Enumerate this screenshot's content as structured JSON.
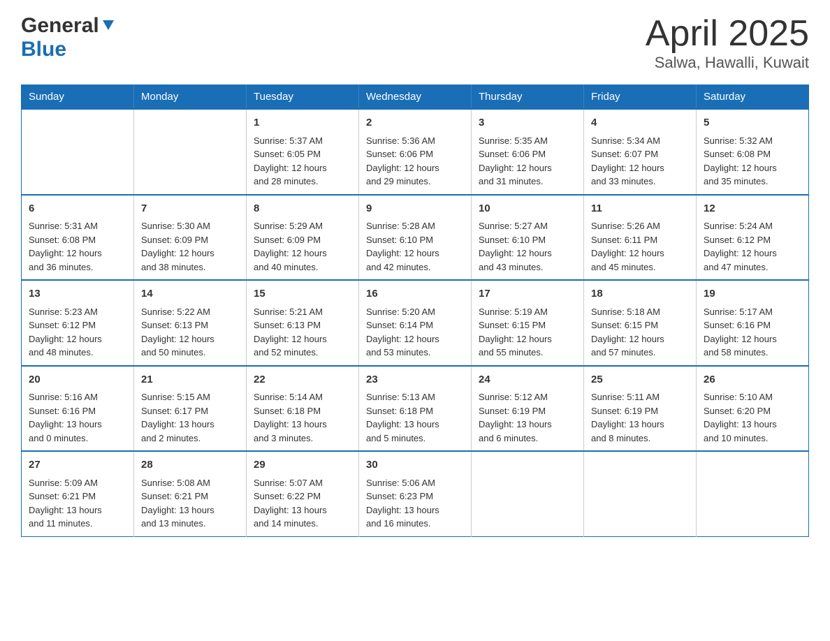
{
  "header": {
    "logo_general": "General",
    "logo_blue": "Blue",
    "title": "April 2025",
    "subtitle": "Salwa, Hawalli, Kuwait"
  },
  "calendar": {
    "days_of_week": [
      "Sunday",
      "Monday",
      "Tuesday",
      "Wednesday",
      "Thursday",
      "Friday",
      "Saturday"
    ],
    "weeks": [
      [
        {
          "day": "",
          "info": ""
        },
        {
          "day": "",
          "info": ""
        },
        {
          "day": "1",
          "info": "Sunrise: 5:37 AM\nSunset: 6:05 PM\nDaylight: 12 hours\nand 28 minutes."
        },
        {
          "day": "2",
          "info": "Sunrise: 5:36 AM\nSunset: 6:06 PM\nDaylight: 12 hours\nand 29 minutes."
        },
        {
          "day": "3",
          "info": "Sunrise: 5:35 AM\nSunset: 6:06 PM\nDaylight: 12 hours\nand 31 minutes."
        },
        {
          "day": "4",
          "info": "Sunrise: 5:34 AM\nSunset: 6:07 PM\nDaylight: 12 hours\nand 33 minutes."
        },
        {
          "day": "5",
          "info": "Sunrise: 5:32 AM\nSunset: 6:08 PM\nDaylight: 12 hours\nand 35 minutes."
        }
      ],
      [
        {
          "day": "6",
          "info": "Sunrise: 5:31 AM\nSunset: 6:08 PM\nDaylight: 12 hours\nand 36 minutes."
        },
        {
          "day": "7",
          "info": "Sunrise: 5:30 AM\nSunset: 6:09 PM\nDaylight: 12 hours\nand 38 minutes."
        },
        {
          "day": "8",
          "info": "Sunrise: 5:29 AM\nSunset: 6:09 PM\nDaylight: 12 hours\nand 40 minutes."
        },
        {
          "day": "9",
          "info": "Sunrise: 5:28 AM\nSunset: 6:10 PM\nDaylight: 12 hours\nand 42 minutes."
        },
        {
          "day": "10",
          "info": "Sunrise: 5:27 AM\nSunset: 6:10 PM\nDaylight: 12 hours\nand 43 minutes."
        },
        {
          "day": "11",
          "info": "Sunrise: 5:26 AM\nSunset: 6:11 PM\nDaylight: 12 hours\nand 45 minutes."
        },
        {
          "day": "12",
          "info": "Sunrise: 5:24 AM\nSunset: 6:12 PM\nDaylight: 12 hours\nand 47 minutes."
        }
      ],
      [
        {
          "day": "13",
          "info": "Sunrise: 5:23 AM\nSunset: 6:12 PM\nDaylight: 12 hours\nand 48 minutes."
        },
        {
          "day": "14",
          "info": "Sunrise: 5:22 AM\nSunset: 6:13 PM\nDaylight: 12 hours\nand 50 minutes."
        },
        {
          "day": "15",
          "info": "Sunrise: 5:21 AM\nSunset: 6:13 PM\nDaylight: 12 hours\nand 52 minutes."
        },
        {
          "day": "16",
          "info": "Sunrise: 5:20 AM\nSunset: 6:14 PM\nDaylight: 12 hours\nand 53 minutes."
        },
        {
          "day": "17",
          "info": "Sunrise: 5:19 AM\nSunset: 6:15 PM\nDaylight: 12 hours\nand 55 minutes."
        },
        {
          "day": "18",
          "info": "Sunrise: 5:18 AM\nSunset: 6:15 PM\nDaylight: 12 hours\nand 57 minutes."
        },
        {
          "day": "19",
          "info": "Sunrise: 5:17 AM\nSunset: 6:16 PM\nDaylight: 12 hours\nand 58 minutes."
        }
      ],
      [
        {
          "day": "20",
          "info": "Sunrise: 5:16 AM\nSunset: 6:16 PM\nDaylight: 13 hours\nand 0 minutes."
        },
        {
          "day": "21",
          "info": "Sunrise: 5:15 AM\nSunset: 6:17 PM\nDaylight: 13 hours\nand 2 minutes."
        },
        {
          "day": "22",
          "info": "Sunrise: 5:14 AM\nSunset: 6:18 PM\nDaylight: 13 hours\nand 3 minutes."
        },
        {
          "day": "23",
          "info": "Sunrise: 5:13 AM\nSunset: 6:18 PM\nDaylight: 13 hours\nand 5 minutes."
        },
        {
          "day": "24",
          "info": "Sunrise: 5:12 AM\nSunset: 6:19 PM\nDaylight: 13 hours\nand 6 minutes."
        },
        {
          "day": "25",
          "info": "Sunrise: 5:11 AM\nSunset: 6:19 PM\nDaylight: 13 hours\nand 8 minutes."
        },
        {
          "day": "26",
          "info": "Sunrise: 5:10 AM\nSunset: 6:20 PM\nDaylight: 13 hours\nand 10 minutes."
        }
      ],
      [
        {
          "day": "27",
          "info": "Sunrise: 5:09 AM\nSunset: 6:21 PM\nDaylight: 13 hours\nand 11 minutes."
        },
        {
          "day": "28",
          "info": "Sunrise: 5:08 AM\nSunset: 6:21 PM\nDaylight: 13 hours\nand 13 minutes."
        },
        {
          "day": "29",
          "info": "Sunrise: 5:07 AM\nSunset: 6:22 PM\nDaylight: 13 hours\nand 14 minutes."
        },
        {
          "day": "30",
          "info": "Sunrise: 5:06 AM\nSunset: 6:23 PM\nDaylight: 13 hours\nand 16 minutes."
        },
        {
          "day": "",
          "info": ""
        },
        {
          "day": "",
          "info": ""
        },
        {
          "day": "",
          "info": ""
        }
      ]
    ]
  }
}
